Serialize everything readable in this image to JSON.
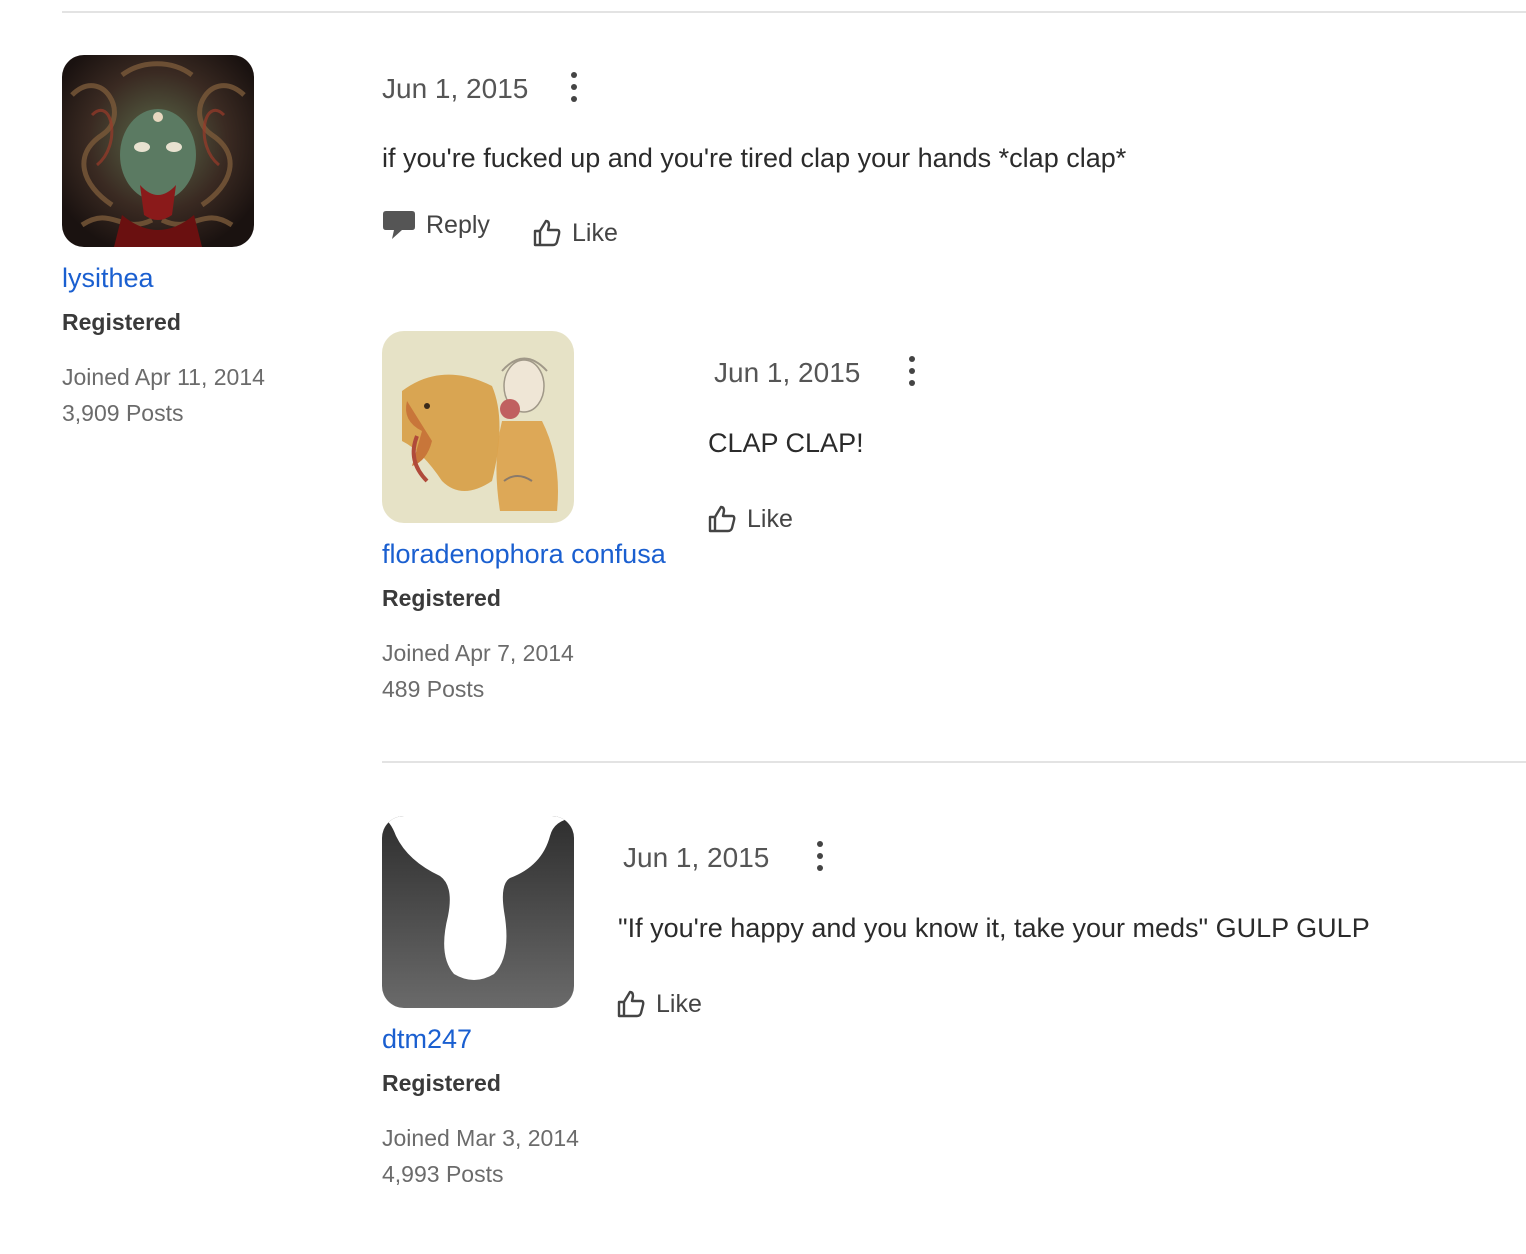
{
  "colors": {
    "link": "#1a5fd0",
    "divider": "#e3e3e3",
    "muted": "#6b6b6b"
  },
  "posts": [
    {
      "user": {
        "name": "lysithea",
        "role": "Registered",
        "joined": "Joined Apr 11, 2014",
        "posts": "3,909 Posts",
        "avatar": "medusa-avatar"
      },
      "date": "Jun 1, 2015",
      "text": "if you're fucked up and you're tired clap your hands *clap clap*",
      "reply_label": "Reply",
      "like_label": "Like"
    },
    {
      "user": {
        "name": "floradenophora confusa",
        "role": "Registered",
        "joined": "Joined Apr 7, 2014",
        "posts": "489 Posts",
        "avatar": "lion-and-woman-avatar"
      },
      "date": "Jun 1, 2015",
      "text": "CLAP CLAP!",
      "like_label": "Like"
    },
    {
      "user": {
        "name": "dtm247",
        "role": "Registered",
        "joined": "Joined Mar 3, 2014",
        "posts": "4,993 Posts",
        "avatar": "silhouette-avatar"
      },
      "date": "Jun 1, 2015",
      "text": "\"If you're happy and you know it, take your meds\" GULP GULP",
      "like_label": "Like"
    }
  ]
}
